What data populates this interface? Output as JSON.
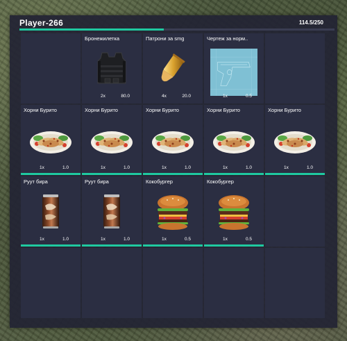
{
  "player": {
    "name": "Player-266",
    "weight_text": "114.5/250",
    "weight_fraction": 0.458
  },
  "colors": {
    "accent": "#1fc9a0",
    "panel": "#222434",
    "slot": "#2b2e42"
  },
  "slots": [
    {
      "name": "",
      "count": "",
      "weight": "",
      "icon": "",
      "bar": false
    },
    {
      "name": "Бронежилетка",
      "count": "2x",
      "weight": "80.0",
      "icon": "body-armor-icon",
      "bar": false
    },
    {
      "name": "Патрони за smg",
      "count": "4x",
      "weight": "20.0",
      "icon": "bullet-icon",
      "bar": false
    },
    {
      "name": "Чертеж за норм..",
      "count": "1x",
      "weight": "0.5",
      "icon": "pistol-blueprint-icon",
      "bar": false
    },
    {
      "name": "",
      "count": "",
      "weight": "",
      "icon": "",
      "bar": false
    },
    {
      "name": "Хорни Бурито",
      "count": "1x",
      "weight": "1.0",
      "icon": "burrito-icon",
      "bar": true
    },
    {
      "name": "Хорни Бурито",
      "count": "1x",
      "weight": "1.0",
      "icon": "burrito-icon",
      "bar": true
    },
    {
      "name": "Хорни Бурито",
      "count": "1x",
      "weight": "1.0",
      "icon": "burrito-icon",
      "bar": true
    },
    {
      "name": "Хорни Бурито",
      "count": "1x",
      "weight": "1.0",
      "icon": "burrito-icon",
      "bar": true
    },
    {
      "name": "Хорни Бурито",
      "count": "1x",
      "weight": "1.0",
      "icon": "burrito-icon",
      "bar": true
    },
    {
      "name": "Руут бира",
      "count": "1x",
      "weight": "1.0",
      "icon": "root-beer-can-icon",
      "bar": true
    },
    {
      "name": "Руут бира",
      "count": "1x",
      "weight": "1.0",
      "icon": "root-beer-can-icon",
      "bar": true
    },
    {
      "name": "Кокобургер",
      "count": "1x",
      "weight": "0.5",
      "icon": "burger-icon",
      "bar": true
    },
    {
      "name": "Кокобургер",
      "count": "1x",
      "weight": "0.5",
      "icon": "burger-icon",
      "bar": true
    },
    {
      "name": "",
      "count": "",
      "weight": "",
      "icon": "",
      "bar": false
    },
    {
      "name": "",
      "count": "",
      "weight": "",
      "icon": "",
      "bar": false
    },
    {
      "name": "",
      "count": "",
      "weight": "",
      "icon": "",
      "bar": false
    },
    {
      "name": "",
      "count": "",
      "weight": "",
      "icon": "",
      "bar": false
    },
    {
      "name": "",
      "count": "",
      "weight": "",
      "icon": "",
      "bar": false
    },
    {
      "name": "",
      "count": "",
      "weight": "",
      "icon": "",
      "bar": false
    }
  ]
}
